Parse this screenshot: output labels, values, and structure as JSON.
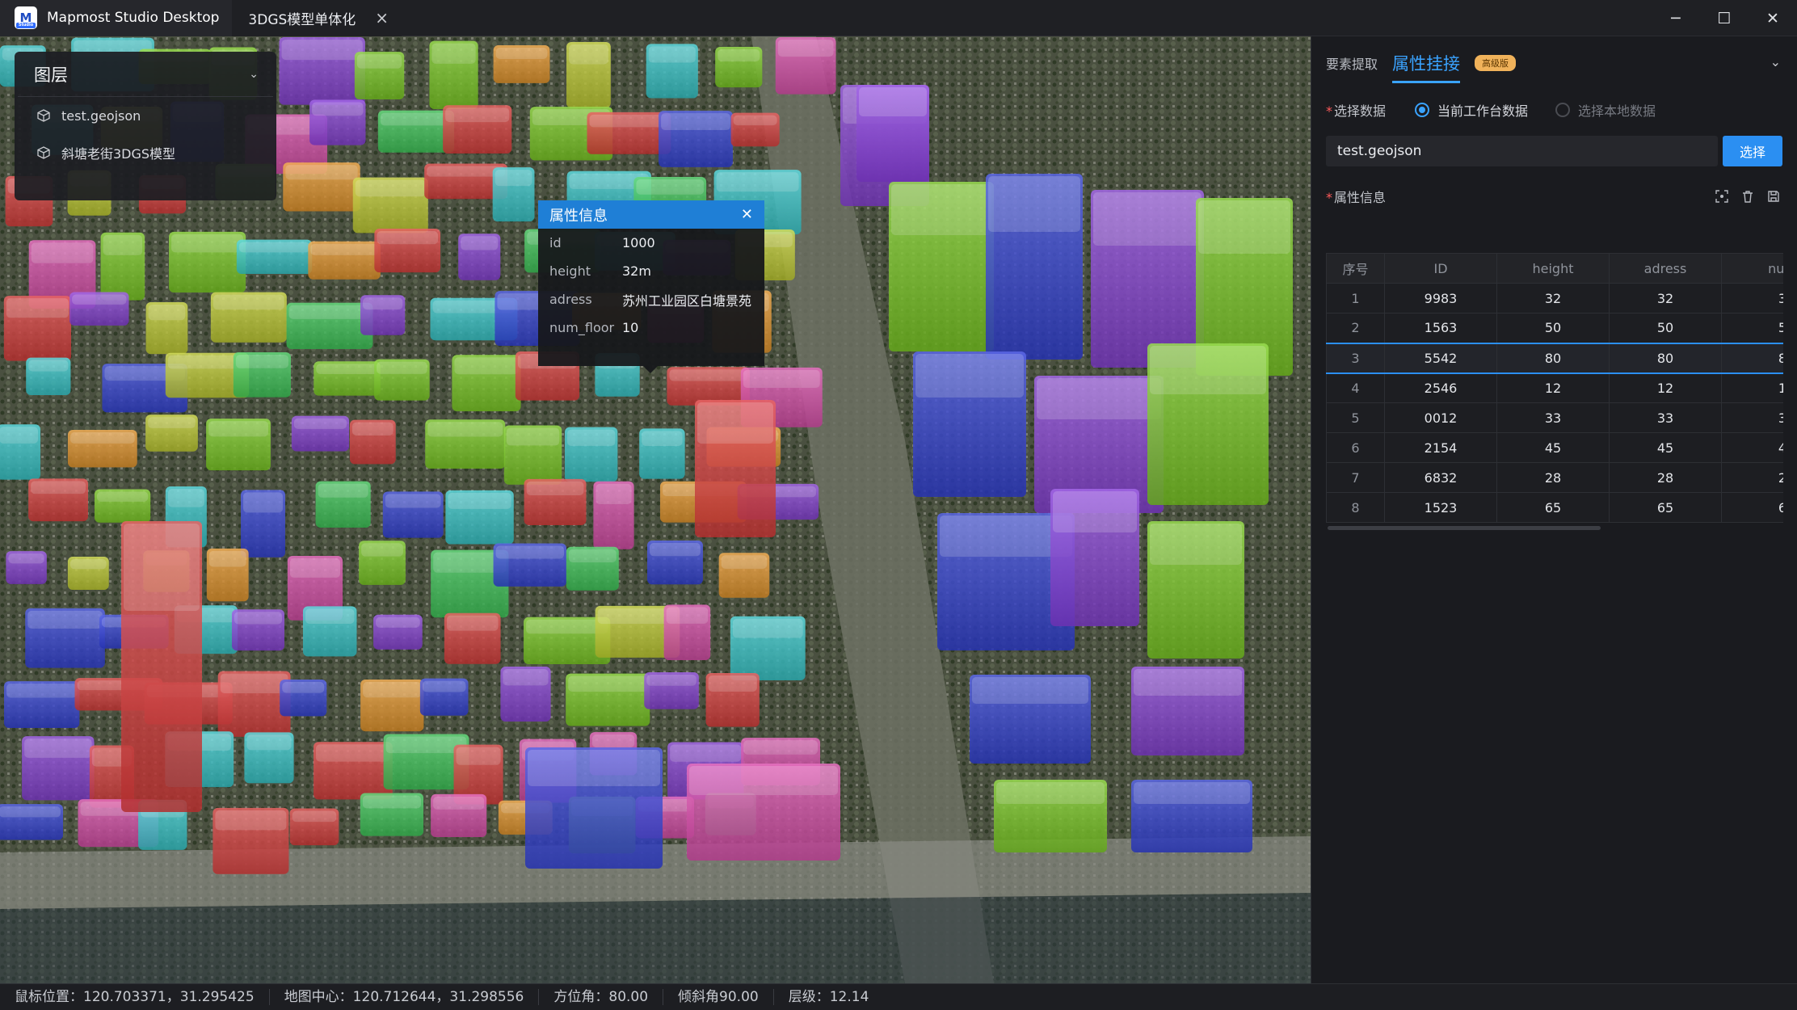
{
  "app": {
    "name": "Mapmost Studio Desktop",
    "logo_letter": "M",
    "logo_sub": "Studio"
  },
  "tabs": [
    {
      "label": "3DGS模型单体化"
    }
  ],
  "window": {
    "minimize": "─",
    "maximize": "☐",
    "close": "✕"
  },
  "layers": {
    "title": "图层",
    "items": [
      {
        "label": "test.geojson"
      },
      {
        "label": "斜塘老街3DGS模型"
      }
    ]
  },
  "popup": {
    "title": "属性信息",
    "rows": [
      {
        "key": "id",
        "value": "1000"
      },
      {
        "key": "height",
        "value": "32m"
      },
      {
        "key": "adress",
        "value": "苏州工业园区白塘景苑"
      },
      {
        "key": "num_floor",
        "value": "10"
      }
    ]
  },
  "panel": {
    "tab_extract": "要素提取",
    "tab_attach": "属性挂接",
    "badge": "高级版",
    "select_data_label": "选择数据",
    "radio_workspace": "当前工作台数据",
    "radio_local": "选择本地数据",
    "selected_file": "test.geojson",
    "select_button": "选择",
    "attr_label": "属性信息",
    "table": {
      "headers": [
        "序号",
        "ID",
        "height",
        "adress",
        "num"
      ],
      "rows": [
        [
          "1",
          "9983",
          "32",
          "32",
          "3"
        ],
        [
          "2",
          "1563",
          "50",
          "50",
          "5"
        ],
        [
          "3",
          "5542",
          "80",
          "80",
          "8"
        ],
        [
          "4",
          "2546",
          "12",
          "12",
          "1"
        ],
        [
          "5",
          "0012",
          "33",
          "33",
          "3"
        ],
        [
          "6",
          "2154",
          "45",
          "45",
          "4"
        ],
        [
          "7",
          "6832",
          "28",
          "28",
          "2"
        ],
        [
          "8",
          "1523",
          "65",
          "65",
          "6"
        ]
      ],
      "selected_row": 3
    }
  },
  "status": {
    "mouse": "鼠标位置：120.703371，31.295425",
    "center": "地图中心：120.712644，31.298556",
    "bearing": "方位角：80.00",
    "pitch": "倾斜角90.00",
    "zoom": "层级：12.14"
  },
  "colors": {
    "accent": "#2b8ff2",
    "tab_active": "#3aa3ff",
    "building_palette": [
      "#e23b3b",
      "#8a3ee0",
      "#c8d430",
      "#33cfd6",
      "#7ed321",
      "#e04ab0",
      "#f09a2a",
      "#2f3fe0",
      "#3ccf5a"
    ]
  }
}
